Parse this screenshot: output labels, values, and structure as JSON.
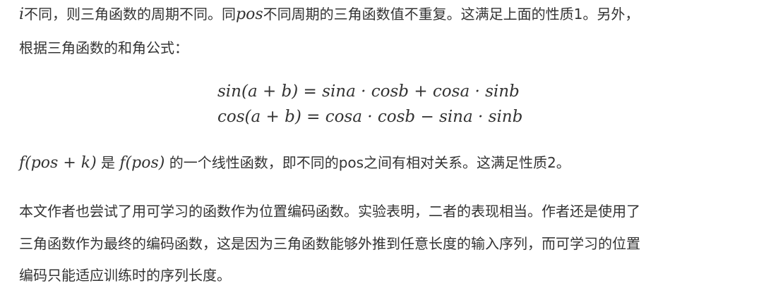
{
  "paragraph1": {
    "line1_math_i": "i",
    "line1_text_a": "不同，则三角函数的周期不同。同",
    "line1_math_pos": "pos",
    "line1_text_b": "不同周期的三角函数值不重复。这满足上面的性质1。另外，",
    "line2_text": "根据三角函数的和角公式："
  },
  "equations": {
    "eq1": "sin(a + b) = sina · cosb + cosa · sinb",
    "eq2": "cos(a + b) = cosa · cosb − sina · sinb"
  },
  "paragraph2": {
    "math_a": "f(pos + k)",
    "text_a": " 是 ",
    "math_b": "f(pos)",
    "text_b": " 的一个线性函数，即不同的pos之间有相对关系。这满足性质2。"
  },
  "paragraph3": {
    "line1": "本文作者也尝试了用可学习的函数作为位置编码函数。实验表明，二者的表现相当。作者还是使用了",
    "line2": "三角函数作为最终的编码函数，这是因为三角函数能够外推到任意长度的输入序列，而可学习的位置",
    "line3": "编码只能适应训练时的序列长度。"
  }
}
